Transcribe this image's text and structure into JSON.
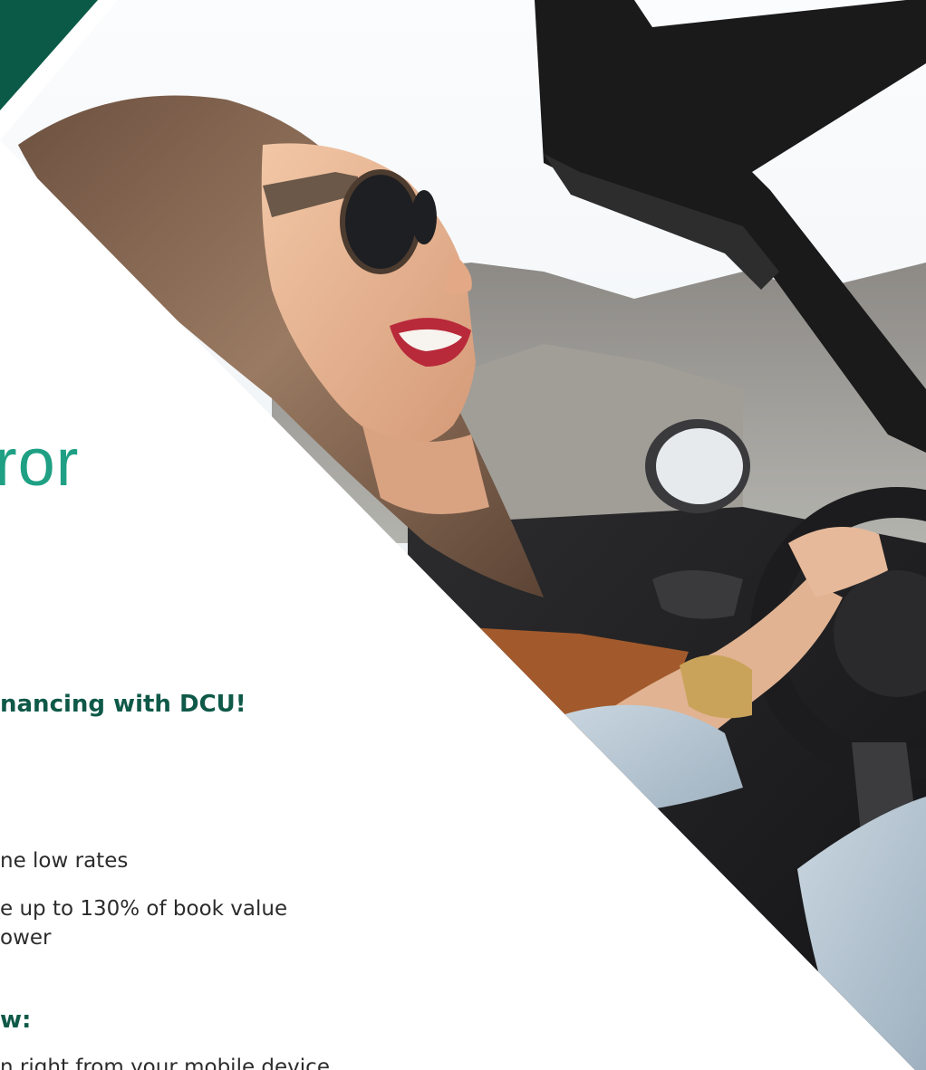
{
  "headline": "ror",
  "subhead": "nancing with DCU!",
  "bullets": [
    "ne low rates",
    "e up to 130% of book value",
    "ower"
  ],
  "section_head": "w:",
  "cutoff_line": "n right from your mobile device",
  "photo_description_icon": "woman-driving-convertible",
  "colors": {
    "brand_green": "#0f5948",
    "accent_teal": "#1fa084",
    "corner_green": "#0b5a47"
  }
}
